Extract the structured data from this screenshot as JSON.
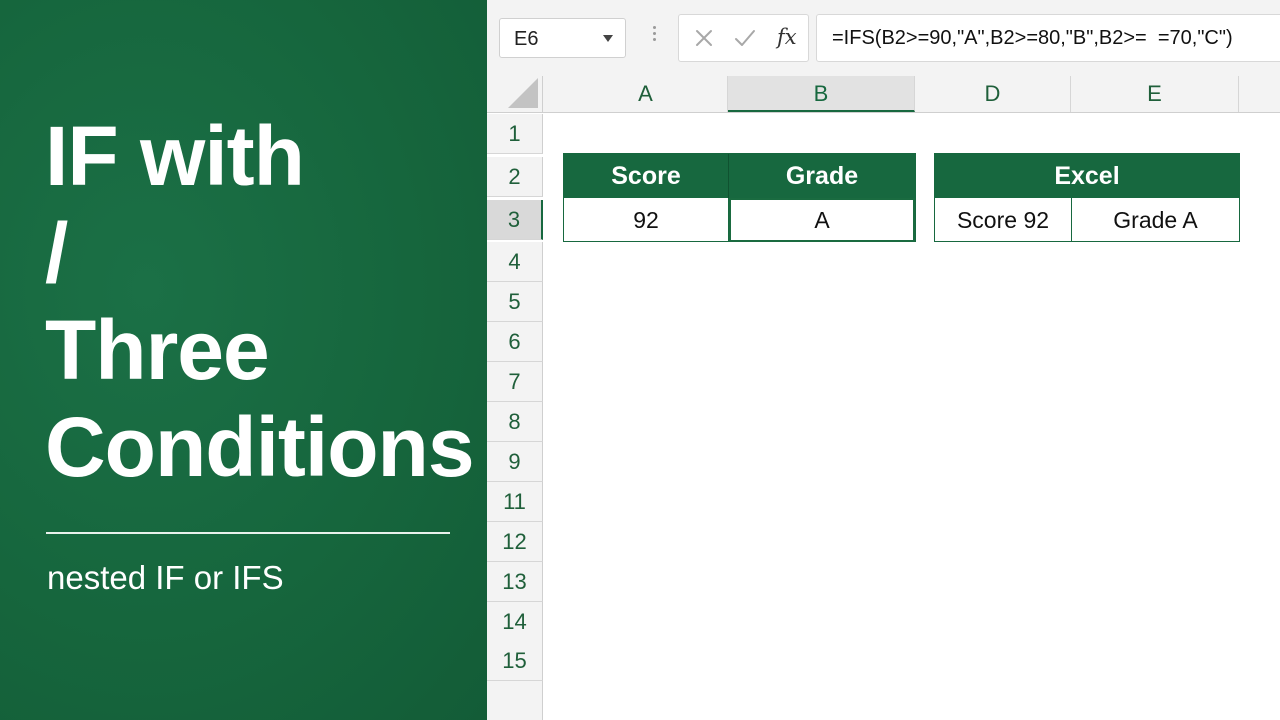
{
  "title_panel": {
    "title_lines": [
      "IF with",
      "/",
      "Three",
      "Conditions"
    ],
    "subtitle": "nested IF or IFS"
  },
  "toolbar": {
    "name_box": "E6",
    "fx_label": "fx",
    "formula": "=IFS(B2>=90,\"A\",B2>=80,\"B\",B2>=  =70,\"C\")",
    "icons": [
      "chevron-down-icon",
      "more-dots-icon",
      "cancel-icon",
      "enter-icon",
      "fx-icon"
    ]
  },
  "sheet": {
    "columns": [
      "A",
      "B",
      "D",
      "E"
    ],
    "active_column": "B",
    "rows": [
      "1",
      "2",
      "3",
      "4",
      "5",
      "6",
      "7",
      "8",
      "9",
      "11",
      "12",
      "13",
      "14",
      "15"
    ],
    "active_row": "3"
  },
  "table_main": {
    "headers": [
      "Score",
      "Grade"
    ],
    "values": [
      "92",
      "A"
    ]
  },
  "table_excel": {
    "header": "Excel",
    "values": [
      "Score 92",
      "Grade A"
    ]
  },
  "colors": {
    "brand_green": "#17683f",
    "header_text": "#ffffff",
    "row_label_green": "#1f5f3a"
  }
}
